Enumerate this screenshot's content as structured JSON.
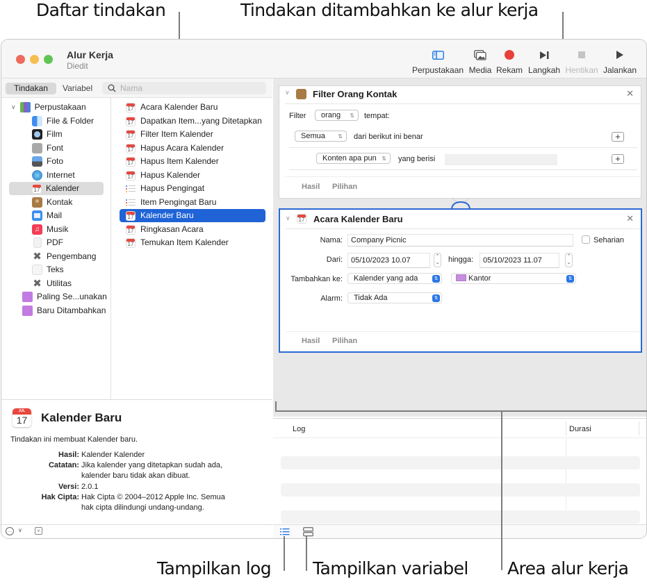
{
  "callouts": {
    "action_list": "Daftar tindakan",
    "added_actions": "Tindakan ditambahkan ke alur kerja",
    "show_log": "Tampilkan log",
    "show_variables": "Tampilkan variabel",
    "workflow_area": "Area alur kerja"
  },
  "window": {
    "title": "Alur Kerja",
    "subtitle": "Diedit"
  },
  "toolbar": {
    "library": "Perpustakaan",
    "media": "Media",
    "record": "Rekam",
    "step": "Langkah",
    "stop": "Hentikan",
    "run": "Jalankan",
    "record_color": "#e8413a",
    "library_color": "#2f7de1"
  },
  "sidebar": {
    "tab_actions": "Tindakan",
    "tab_variables": "Variabel",
    "search_placeholder": "Nama",
    "library_root": "Perpustakaan",
    "categories": [
      {
        "label": "File & Folder",
        "icon": "finder-icon"
      },
      {
        "label": "Film",
        "icon": "quicktime-icon"
      },
      {
        "label": "Font",
        "icon": "font-book-icon"
      },
      {
        "label": "Foto",
        "icon": "photos-icon"
      },
      {
        "label": "Internet",
        "icon": "globe-icon"
      },
      {
        "label": "Kalender",
        "icon": "calendar-icon",
        "selected": true
      },
      {
        "label": "Kontak",
        "icon": "contacts-icon"
      },
      {
        "label": "Mail",
        "icon": "mail-icon"
      },
      {
        "label": "Musik",
        "icon": "music-icon"
      },
      {
        "label": "PDF",
        "icon": "pdf-icon"
      },
      {
        "label": "Pengembang",
        "icon": "developer-tools-icon"
      },
      {
        "label": "Teks",
        "icon": "text-edit-icon"
      },
      {
        "label": "Utilitas",
        "icon": "utilities-icon"
      }
    ],
    "smart_groups": [
      {
        "label": "Paling Se...unakan",
        "icon": "purple-folder-icon"
      },
      {
        "label": "Baru Ditambahkan",
        "icon": "purple-folder-icon"
      }
    ]
  },
  "actions": [
    {
      "label": "Acara Kalender Baru",
      "icon": "calendar-icon"
    },
    {
      "label": "Dapatkan Item...yang Ditetapkan",
      "icon": "calendar-icon"
    },
    {
      "label": "Filter Item Kalender",
      "icon": "calendar-icon"
    },
    {
      "label": "Hapus Acara Kalender",
      "icon": "calendar-icon"
    },
    {
      "label": "Hapus Item Kalender",
      "icon": "calendar-icon"
    },
    {
      "label": "Hapus Kalender",
      "icon": "calendar-icon"
    },
    {
      "label": "Hapus Pengingat",
      "icon": "reminders-icon"
    },
    {
      "label": "Item Pengingat Baru",
      "icon": "reminders-icon"
    },
    {
      "label": "Kalender Baru",
      "icon": "calendar-icon",
      "selected": true
    },
    {
      "label": "Ringkasan Acara",
      "icon": "calendar-icon"
    },
    {
      "label": "Temukan Item Kalender",
      "icon": "calendar-icon"
    }
  ],
  "description": {
    "icon_month": "JUL",
    "icon_day": "17",
    "title": "Kalender Baru",
    "summary": "Tindakan ini membuat Kalender baru.",
    "rows": [
      {
        "label": "Hasil:",
        "lines": [
          "Kalender Kalender"
        ]
      },
      {
        "label": "Catatan:",
        "lines": [
          "Jika kalender yang ditetapkan sudah ada,",
          "kalender baru tidak akan dibuat."
        ]
      },
      {
        "label": "Versi:",
        "lines": [
          "2.0.1"
        ]
      },
      {
        "label": "Hak Cipta:",
        "lines": [
          "Hak Cipta © 2004–2012 Apple Inc.  Semua",
          "hak cipta dilindungi undang-undang."
        ]
      }
    ]
  },
  "workflow": {
    "filter_action": {
      "title": "Filter Orang Kontak",
      "filter_label": "Filter",
      "filter_value": "orang",
      "where_label": "tempat:",
      "match_value": "Semua",
      "match_suffix": "dari berikut ini benar",
      "criterion_value": "Konten apa pun",
      "criterion_op": "yang berisi",
      "criterion_text": "",
      "tab_results": "Hasil",
      "tab_options": "Pilihan"
    },
    "event_action": {
      "title": "Acara Kalender Baru",
      "name_label": "Nama:",
      "name_value": "Company Picnic",
      "allday_label": "Seharian",
      "allday_checked": false,
      "from_label": "Dari:",
      "from_value": "05/10/2023 10.07",
      "to_label": "hingga:",
      "to_value": "05/10/2023 11.07",
      "add_to_label": "Tambahkan ke:",
      "add_to_value": "Kalender yang ada",
      "calendar_value": "Kantor",
      "calendar_color": "#c78ee0",
      "alarm_label": "Alarm:",
      "alarm_value": "Tidak Ada",
      "tab_results": "Hasil",
      "tab_options": "Pilihan"
    }
  },
  "log": {
    "col_log": "Log",
    "col_duration": "Durasi",
    "rows": []
  }
}
